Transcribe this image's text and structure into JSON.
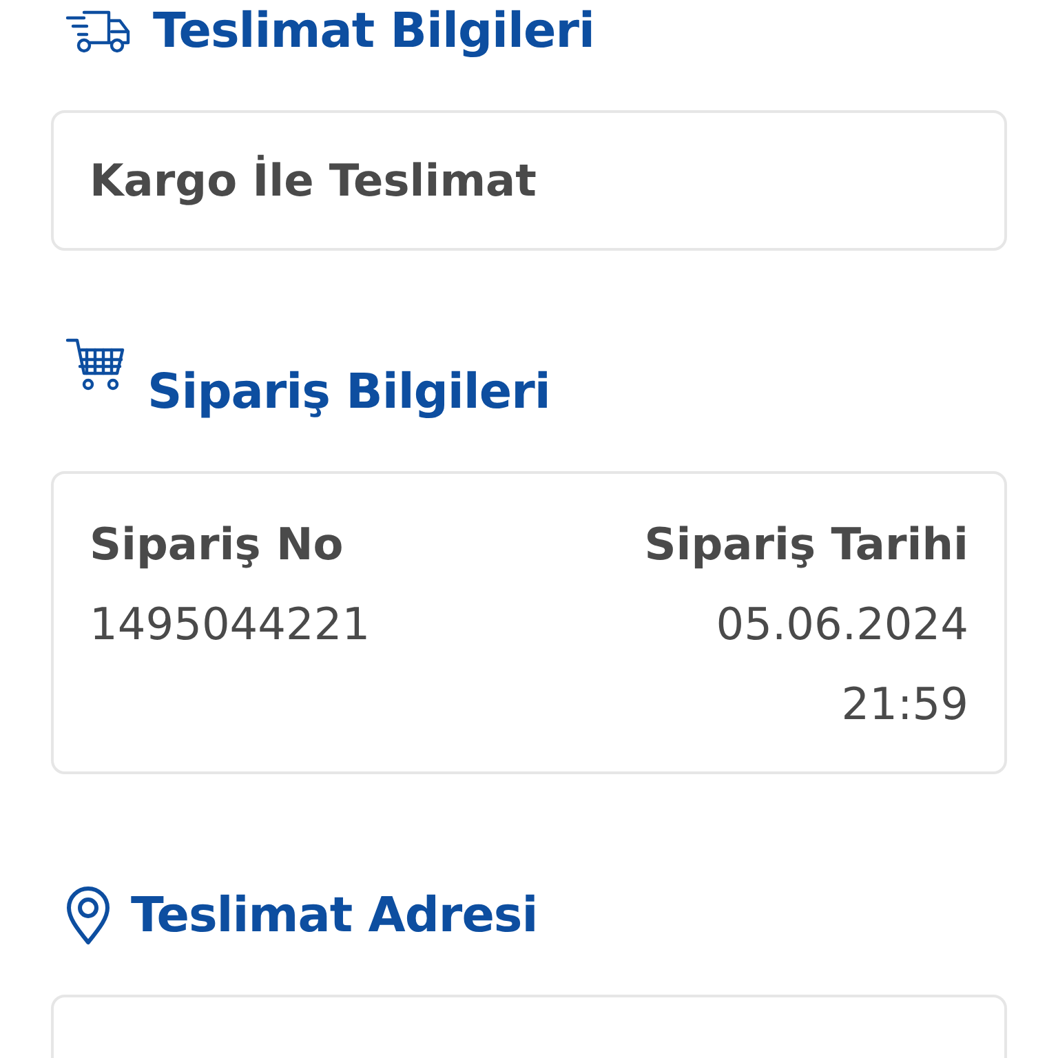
{
  "sections": [
    {
      "kind": "delivery",
      "title": "Teslimat Bilgileri",
      "text": "Kargo İle Teslimat"
    },
    {
      "kind": "order",
      "title": "Sipariş Bilgileri",
      "fields": [
        {
          "label": "Sipariş No",
          "value": "1495044221"
        },
        {
          "label": "Sipariş Tarihi",
          "value": "05.06.2024",
          "value2": "21:59"
        }
      ]
    },
    {
      "kind": "address",
      "title": "Teslimat Adresi"
    }
  ]
}
